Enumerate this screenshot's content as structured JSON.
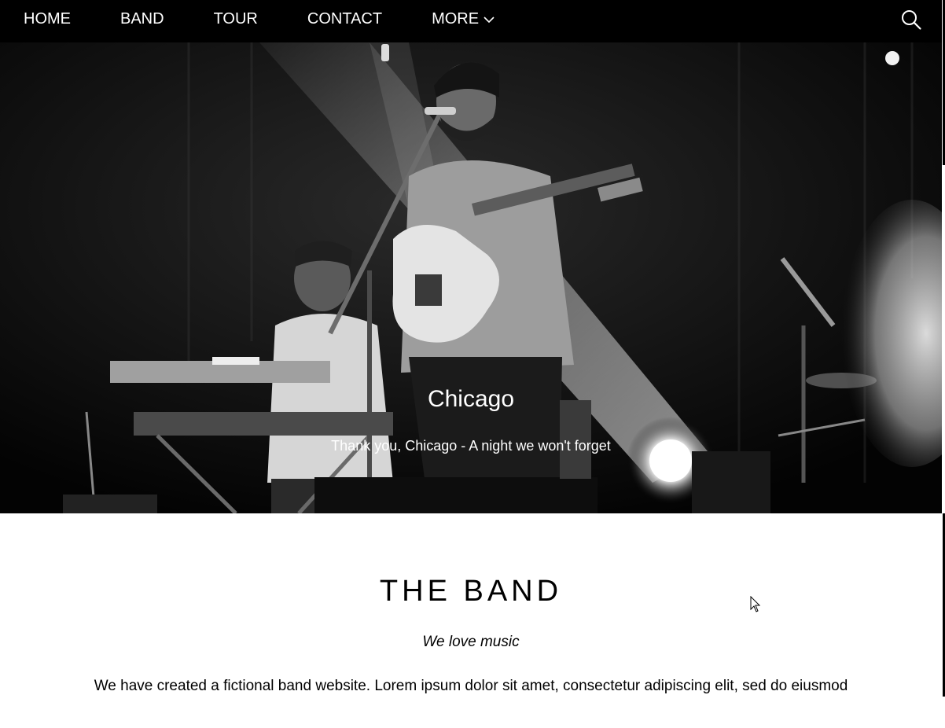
{
  "nav": {
    "items": [
      {
        "label": "HOME"
      },
      {
        "label": "BAND"
      },
      {
        "label": "TOUR"
      },
      {
        "label": "CONTACT"
      },
      {
        "label": "MORE"
      }
    ]
  },
  "icons": {
    "search": "search-icon",
    "more_dropdown": "chevron-down-icon"
  },
  "hero": {
    "title": "Chicago",
    "subtitle": "Thank you, Chicago - A night we won't forget"
  },
  "band": {
    "title": "THE BAND",
    "tagline": "We love music",
    "description": "We have created a fictional band website. Lorem ipsum dolor sit amet, consectetur adipiscing elit, sed do eiusmod"
  },
  "colors": {
    "nav_background": "#000000",
    "nav_text": "#ffffff",
    "page_background": "#ffffff"
  }
}
